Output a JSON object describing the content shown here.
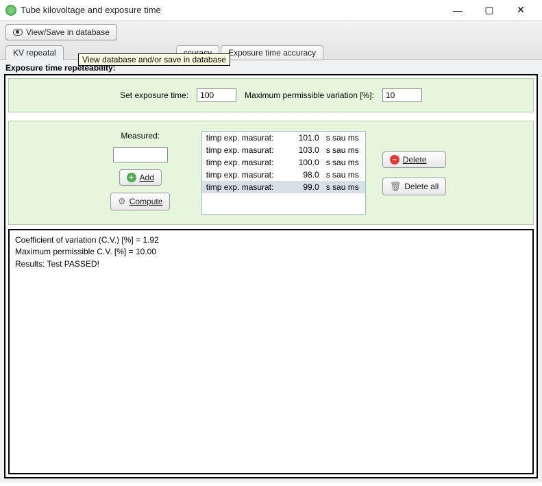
{
  "window": {
    "title": "Tube kilovoltage and exposure time"
  },
  "toolbar": {
    "view_save_label": "View/Save in database",
    "tooltip": "View database and/or save in database"
  },
  "tabs": {
    "t0": "KV repeatal",
    "t1": "ccuracy",
    "t2": "Exposure time accuracy"
  },
  "section": {
    "title": "Exposure time repeteability:"
  },
  "row1": {
    "set_label": "Set exposure time:",
    "set_value": "100",
    "max_label": "Maximum permissible variation [%]:",
    "max_value": "10"
  },
  "measured": {
    "label": "Measured:",
    "add_label": "Add",
    "compute_label": "Compute"
  },
  "list": {
    "col_label": "timp exp. masurat:",
    "unit": "s sau ms",
    "items": [
      {
        "val": "101.0"
      },
      {
        "val": "103.0"
      },
      {
        "val": "100.0"
      },
      {
        "val": "98.0"
      },
      {
        "val": "99.0"
      }
    ]
  },
  "delete": {
    "one": "Delete",
    "all": "Delete all"
  },
  "results": {
    "line1": "Coefficient of variation (C.V.) [%] = 1.92",
    "line2": "Maximum permissible C.V. [%] = 10.00",
    "line3": "Results:  Test PASSED!"
  }
}
